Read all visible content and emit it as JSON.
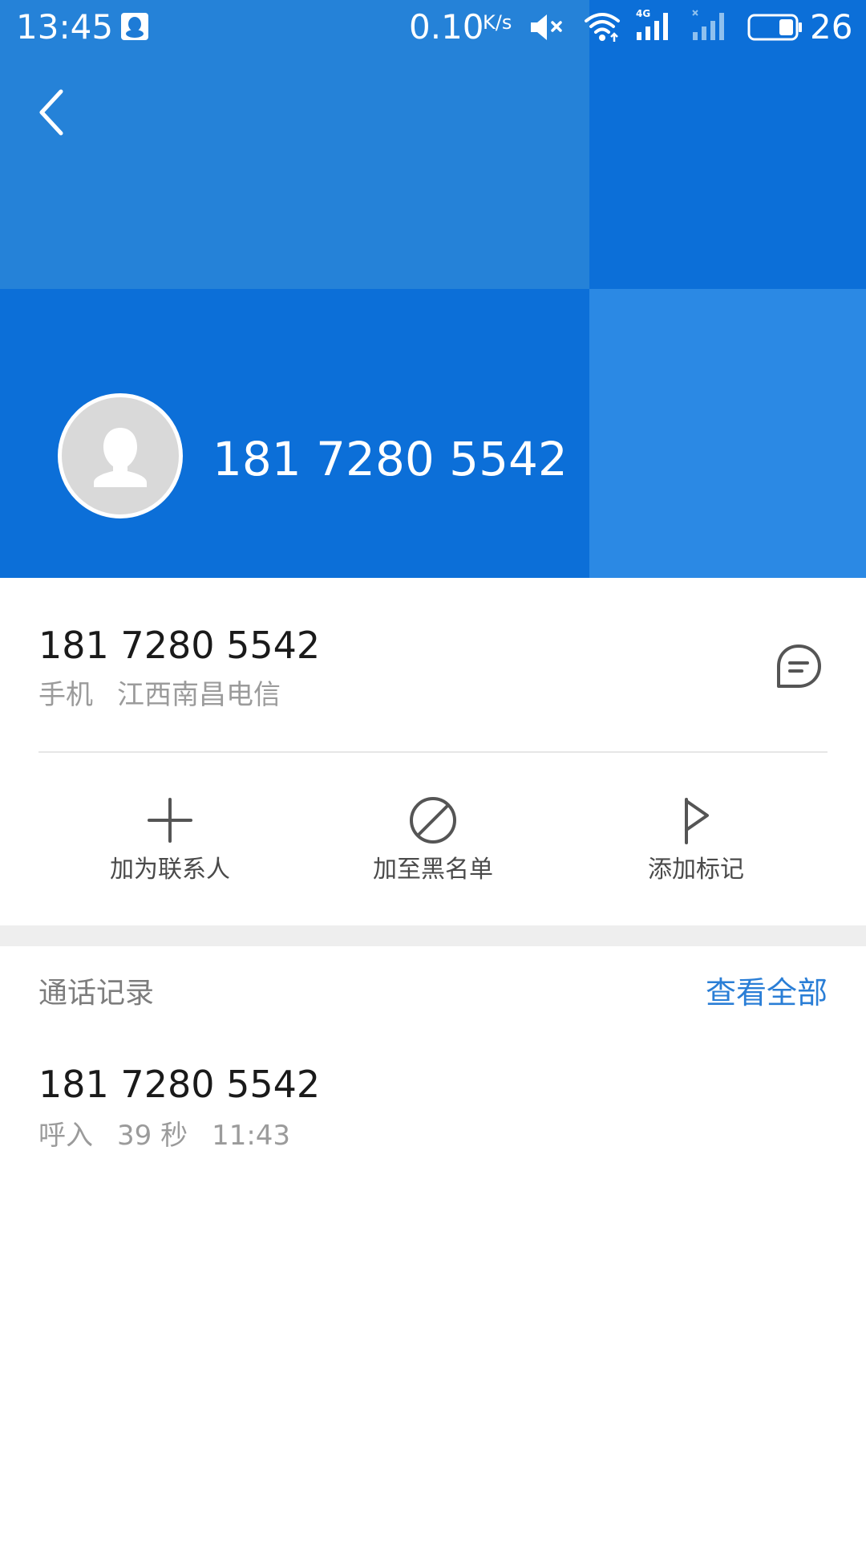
{
  "status_bar": {
    "time": "13:45",
    "net_speed": "0.10",
    "net_speed_unit": "K/s",
    "battery_level": "26",
    "icons": [
      "qq-icon",
      "mute-icon",
      "wifi-icon",
      "signal-4g-icon",
      "signal-nosim-icon",
      "battery-icon"
    ]
  },
  "header": {
    "number": "181 7280 5542",
    "colors": {
      "tile_top_left": "#2582d8",
      "tile_top_right": "#0c6fd8",
      "tile_bottom_left": "#0c6fd8",
      "tile_bottom_right": "#2b89e4"
    }
  },
  "contact": {
    "number": "181 7280 5542",
    "type": "手机",
    "location": "江西南昌电信"
  },
  "actions": [
    {
      "label": "加为联系人",
      "icon": "plus-icon"
    },
    {
      "label": "加至黑名单",
      "icon": "block-icon"
    },
    {
      "label": "添加标记",
      "icon": "flag-icon"
    }
  ],
  "call_log": {
    "title": "通话记录",
    "view_all": "查看全部",
    "accent_color": "#2a7ed6",
    "items": [
      {
        "number": "181 7280 5542",
        "direction": "呼入",
        "duration": "39 秒",
        "time": "11:43"
      }
    ]
  }
}
